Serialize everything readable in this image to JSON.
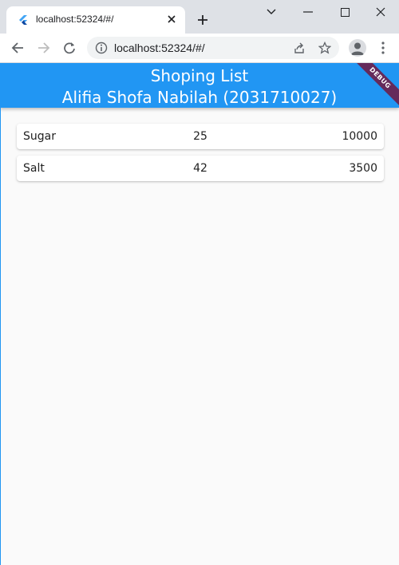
{
  "browser": {
    "tab_title": "localhost:52324/#/",
    "url": "localhost:52324/#/",
    "icons": [
      "flutter-favicon-icon",
      "close-icon",
      "plus-icon",
      "chevron-down-icon",
      "minimize-icon",
      "maximize-icon",
      "close-window-icon",
      "back-arrow-icon",
      "forward-arrow-icon",
      "reload-icon",
      "info-icon",
      "share-icon",
      "star-icon",
      "profile-icon",
      "more-vert-icon"
    ]
  },
  "app": {
    "title_line1": "Shoping List",
    "title_line2": "Alifia Shofa Nabilah (2031710027)",
    "debug_label": "DEBUG",
    "accent_color": "#2196f3",
    "items": [
      {
        "name": "Sugar",
        "quantity": "25",
        "price": "10000"
      },
      {
        "name": "Salt",
        "quantity": "42",
        "price": "3500"
      }
    ]
  }
}
